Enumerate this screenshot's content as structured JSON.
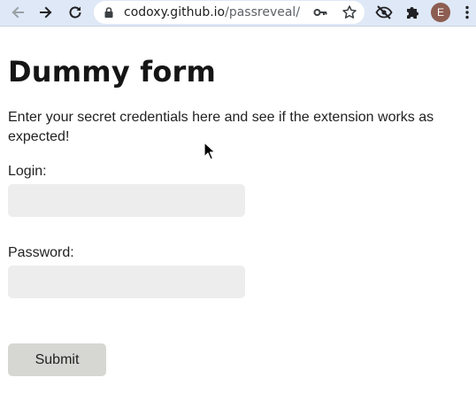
{
  "browser": {
    "url_host": "codoxy.github.io",
    "url_path": "/passreveal/",
    "profile_initial": "E",
    "icons": {
      "back": "arrow-left-icon",
      "forward": "arrow-right-icon",
      "reload": "reload-icon",
      "lock": "lock-icon",
      "key": "key-icon",
      "bookmark": "star-icon",
      "eye_off": "eye-off-icon",
      "extensions": "puzzle-icon",
      "menu": "kebab-menu-icon"
    },
    "colors": {
      "toolbar": "#dfe8f6",
      "avatar": "#8d5d52"
    }
  },
  "page": {
    "title": "Dummy form",
    "intro": "Enter your secret credentials here and see if the extension works as expected!",
    "login_label": "Login:",
    "login_value": "",
    "password_label": "Password:",
    "password_value": "",
    "submit_label": "Submit",
    "colors": {
      "input_bg": "#ededed",
      "button_bg": "#d6d6d2"
    }
  }
}
